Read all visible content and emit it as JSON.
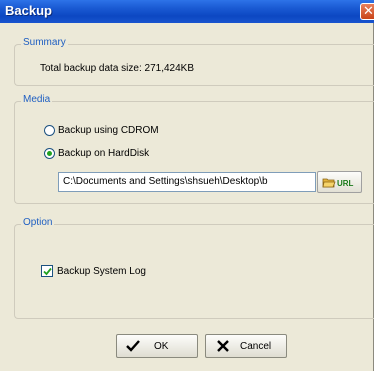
{
  "window": {
    "title": "Backup",
    "close_glyph": "✕"
  },
  "summary": {
    "legend": "Summary",
    "total_size_text": "Total backup data size: 271,424KB"
  },
  "media": {
    "legend": "Media",
    "option_cdrom": {
      "label": "Backup using CDROM",
      "selected": false
    },
    "option_harddisk": {
      "label": "Backup on HardDisk",
      "selected": true
    },
    "path_value": "C:\\Documents and Settings\\shsueh\\Desktop\\b",
    "browse_icon": "folder-url-icon",
    "browse_icon_text": "URL"
  },
  "option": {
    "legend": "Option",
    "backup_system_log": {
      "label": "Backup System Log",
      "checked": true
    }
  },
  "buttons": {
    "ok": {
      "label": "OK",
      "icon": "check-icon"
    },
    "cancel": {
      "label": "Cancel",
      "icon": "x-icon"
    }
  },
  "colors": {
    "titlebar": "#0c47c2",
    "legend_text": "#1f5fc2",
    "radio_dot": "#21a121",
    "close_button": "#c94418"
  }
}
